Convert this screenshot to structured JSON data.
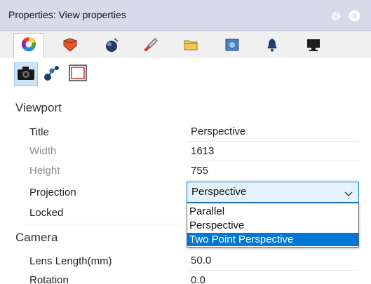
{
  "window": {
    "title": "Properties: View properties",
    "settings_icon": "gear-icon",
    "close_icon": "close-icon"
  },
  "tabs": [
    {
      "icon": "color-wheel-icon"
    },
    {
      "icon": "material-icon"
    },
    {
      "icon": "render-icon"
    },
    {
      "icon": "brush-icon"
    },
    {
      "icon": "folder-icon"
    },
    {
      "icon": "image-icon"
    },
    {
      "icon": "bell-icon"
    },
    {
      "icon": "monitor-icon"
    }
  ],
  "subtools": [
    {
      "icon": "camera-icon"
    },
    {
      "icon": "molecule-icon"
    },
    {
      "icon": "frame-icon"
    }
  ],
  "viewport": {
    "heading": "Viewport",
    "title_label": "Title",
    "title_value": "Perspective",
    "width_label": "Width",
    "width_value": "1613",
    "height_label": "Height",
    "height_value": "755",
    "projection_label": "Projection",
    "projection_value": "Perspective",
    "locked_label": "Locked",
    "projection_options": [
      "Parallel",
      "Perspective",
      "Two Point Perspective"
    ],
    "projection_highlighted": "Two Point Perspective"
  },
  "camera": {
    "heading": "Camera",
    "lens_label": "Lens Length(mm)",
    "lens_value": "50.0",
    "rotation_label": "Rotation",
    "rotation_value": "0.0"
  },
  "colors": {
    "accent": "#0078d7",
    "titlebar": "#d6dbe9"
  }
}
